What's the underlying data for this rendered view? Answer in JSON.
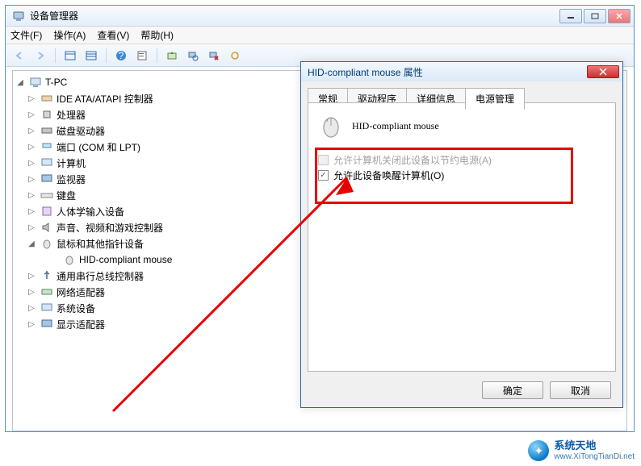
{
  "window": {
    "title": "设备管理器"
  },
  "menu": {
    "file": "文件(F)",
    "action": "操作(A)",
    "view": "查看(V)",
    "help": "帮助(H)"
  },
  "tree": {
    "root": "T-PC",
    "items": [
      "IDE ATA/ATAPI 控制器",
      "处理器",
      "磁盘驱动器",
      "端口 (COM 和 LPT)",
      "计算机",
      "监视器",
      "键盘",
      "人体学输入设备",
      "声音、视频和游戏控制器",
      "鼠标和其他指针设备",
      "HID-compliant mouse",
      "通用串行总线控制器",
      "网络适配器",
      "系统设备",
      "显示适配器"
    ]
  },
  "dialog": {
    "title": "HID-compliant mouse 属性",
    "tabs": {
      "general": "常规",
      "driver": "驱动程序",
      "details": "详细信息",
      "power": "电源管理"
    },
    "device_name": "HID-compliant mouse",
    "checkbox1": "允许计算机关闭此设备以节约电源(A)",
    "checkbox2": "允许此设备唤醒计算机(O)",
    "ok": "确定",
    "cancel": "取消"
  },
  "watermark": {
    "title": "系统天地",
    "url": "www.XiTongTianDi.net"
  }
}
